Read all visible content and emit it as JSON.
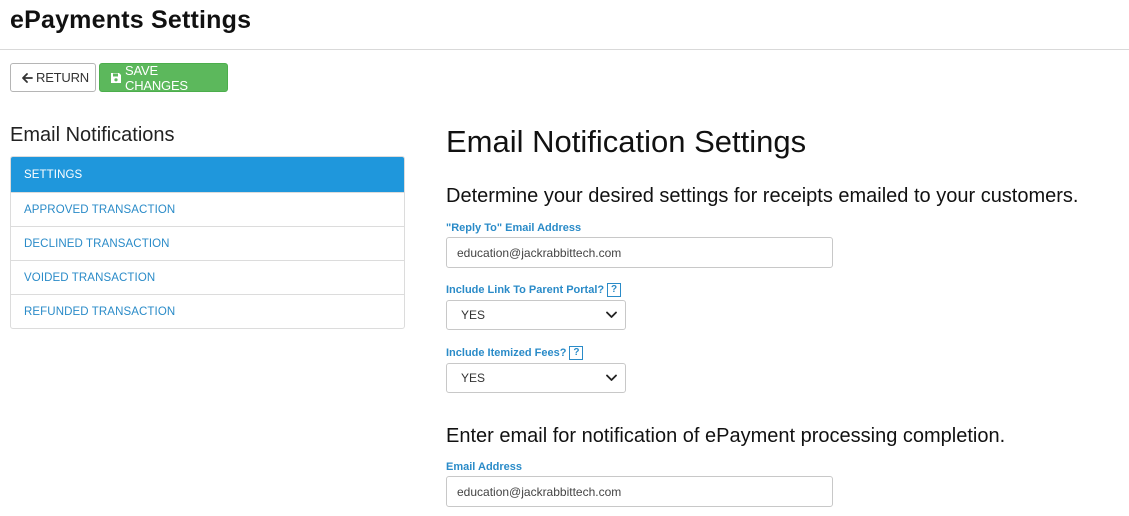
{
  "header": {
    "title": "ePayments Settings"
  },
  "toolbar": {
    "return_label": "RETURN",
    "save_label": "SAVE CHANGES"
  },
  "sidebar": {
    "title": "Email Notifications",
    "items": [
      {
        "label": "SETTINGS"
      },
      {
        "label": "APPROVED TRANSACTION"
      },
      {
        "label": "DECLINED TRANSACTION"
      },
      {
        "label": "VOIDED TRANSACTION"
      },
      {
        "label": "REFUNDED TRANSACTION"
      }
    ]
  },
  "main": {
    "title": "Email Notification Settings",
    "receipts_text": "Determine your desired settings for receipts emailed to your customers.",
    "reply_to": {
      "label": "\"Reply To\" Email Address",
      "value": "education@jackrabbittech.com"
    },
    "parent_portal": {
      "label": "Include Link To Parent Portal?",
      "value": "YES",
      "help": "?"
    },
    "itemized_fees": {
      "label": "Include Itemized Fees?",
      "value": "YES",
      "help": "?"
    },
    "processing_text": "Enter email for notification of ePayment processing completion.",
    "notify_email": {
      "label": "Email Address",
      "value": "education@jackrabbittech.com"
    }
  },
  "colors": {
    "accent": "#1f97dc",
    "link": "#2a8bc8",
    "save_button": "#5cb85c"
  }
}
